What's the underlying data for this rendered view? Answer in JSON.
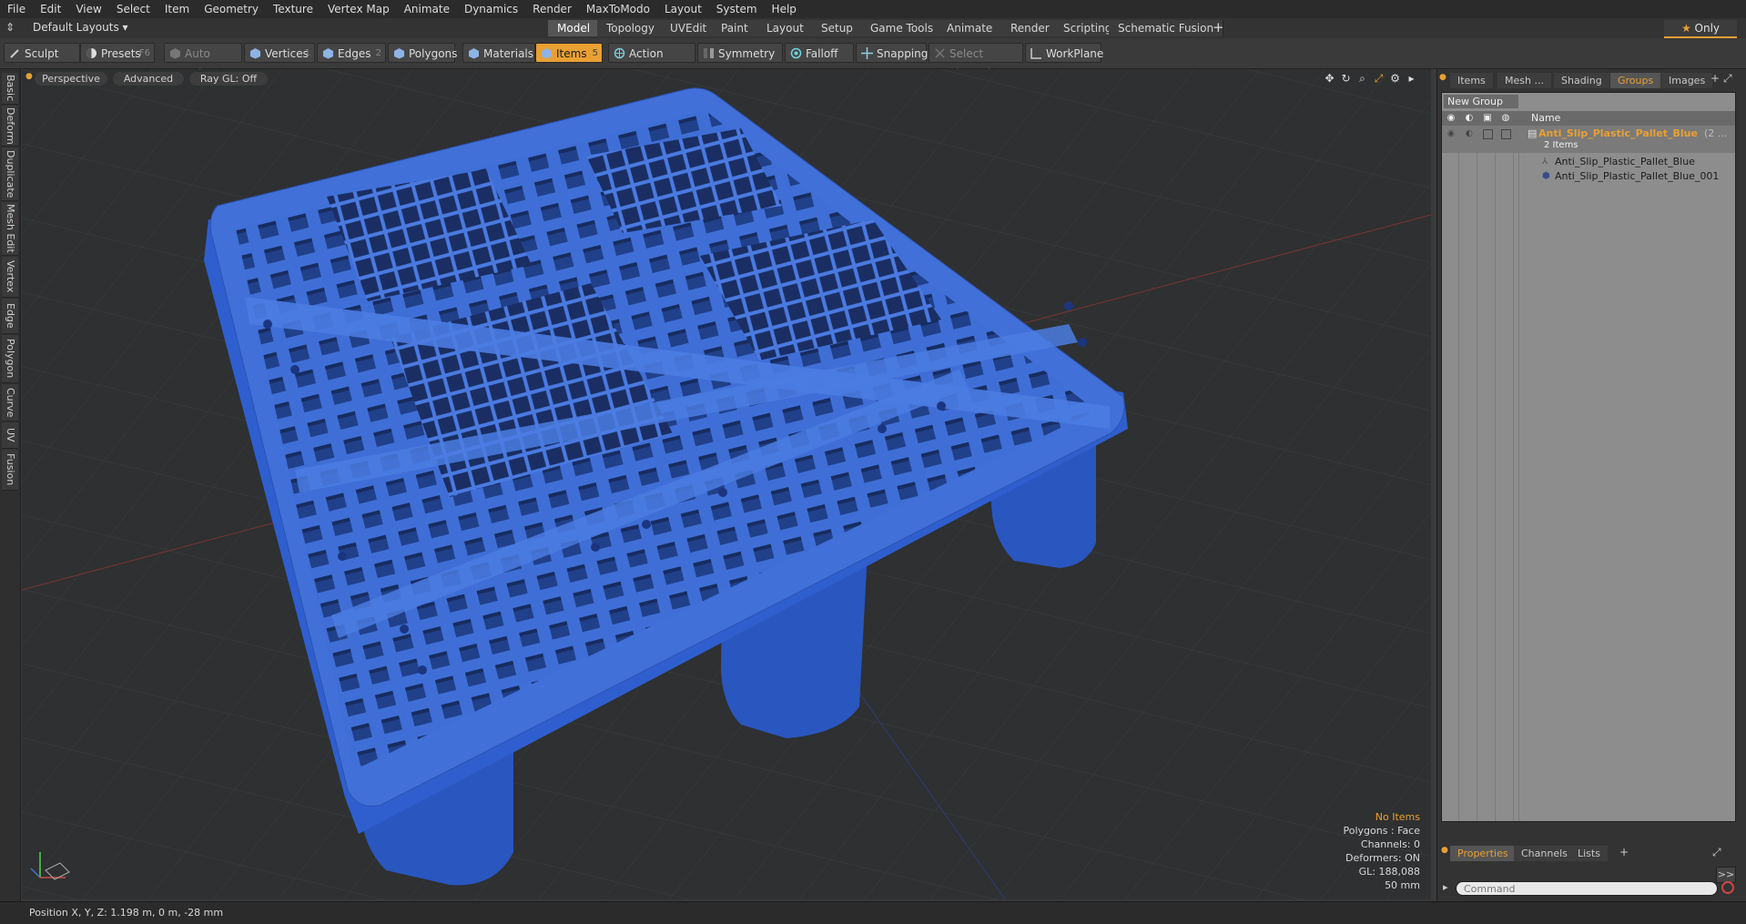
{
  "menu": [
    "File",
    "Edit",
    "View",
    "Select",
    "Item",
    "Geometry",
    "Texture",
    "Vertex Map",
    "Animate",
    "Dynamics",
    "Render",
    "MaxToModo",
    "Layout",
    "System",
    "Help"
  ],
  "layout": {
    "preset": "Default Layouts",
    "tabs": [
      "Model",
      "Topology",
      "UVEdit",
      "Paint",
      "Layout",
      "Setup",
      "Game Tools",
      "Animate",
      "Render",
      "Scripting",
      "Schematic Fusion"
    ],
    "active_tab": "Model",
    "only_label": "Only"
  },
  "toolbar": {
    "sculpt": "Sculpt",
    "presets": "Presets",
    "presets_key": "F6",
    "auto_select": "Auto Select",
    "vertices": "Vertices",
    "vertices_key": "1",
    "edges": "Edges",
    "edges_key": "2",
    "polygons": "Polygons",
    "materials": "Materials",
    "items": "Items",
    "items_key": "5",
    "action_center": "Action Center",
    "symmetry": "Symmetry",
    "falloff": "Falloff",
    "snapping": "Snapping",
    "select_through": "Select Through",
    "workplane": "WorkPlane"
  },
  "left_tabs": [
    "Basic",
    "Deform",
    "Duplicate",
    "Mesh Edit",
    "Vertex",
    "Edge",
    "Polygon",
    "Curve",
    "UV",
    "Fusion"
  ],
  "viewport": {
    "view": "Perspective",
    "shading": "Advanced",
    "raygl": "Ray GL: Off",
    "info": {
      "selection": "No Items",
      "polygons": "Polygons : Face",
      "channels": "Channels: 0",
      "deformers": "Deformers: ON",
      "gl": "GL: 188,088",
      "grid": "50 mm"
    },
    "model_color": "#3f6fd6"
  },
  "right_panel": {
    "tabs": [
      "Items",
      "Mesh ...",
      "Shading",
      "Groups",
      "Images"
    ],
    "active_tab": "Groups",
    "new_group": "New Group",
    "name_col": "Name",
    "group": {
      "name": "Anti_Slip_Plastic_Pallet_Blue",
      "suffix": "(2 ...",
      "count": "2 Items",
      "children": [
        "Anti_Slip_Plastic_Pallet_Blue",
        "Anti_Slip_Plastic_Pallet_Blue_001"
      ]
    },
    "bottom_tabs": [
      "Properties",
      "Channels",
      "Lists"
    ],
    "active_bottom_tab": "Properties",
    "command_placeholder": "Command",
    "accent": "#e8a033"
  },
  "status": {
    "position": "Position X, Y, Z:  1.198 m, 0 m, -28 mm"
  }
}
